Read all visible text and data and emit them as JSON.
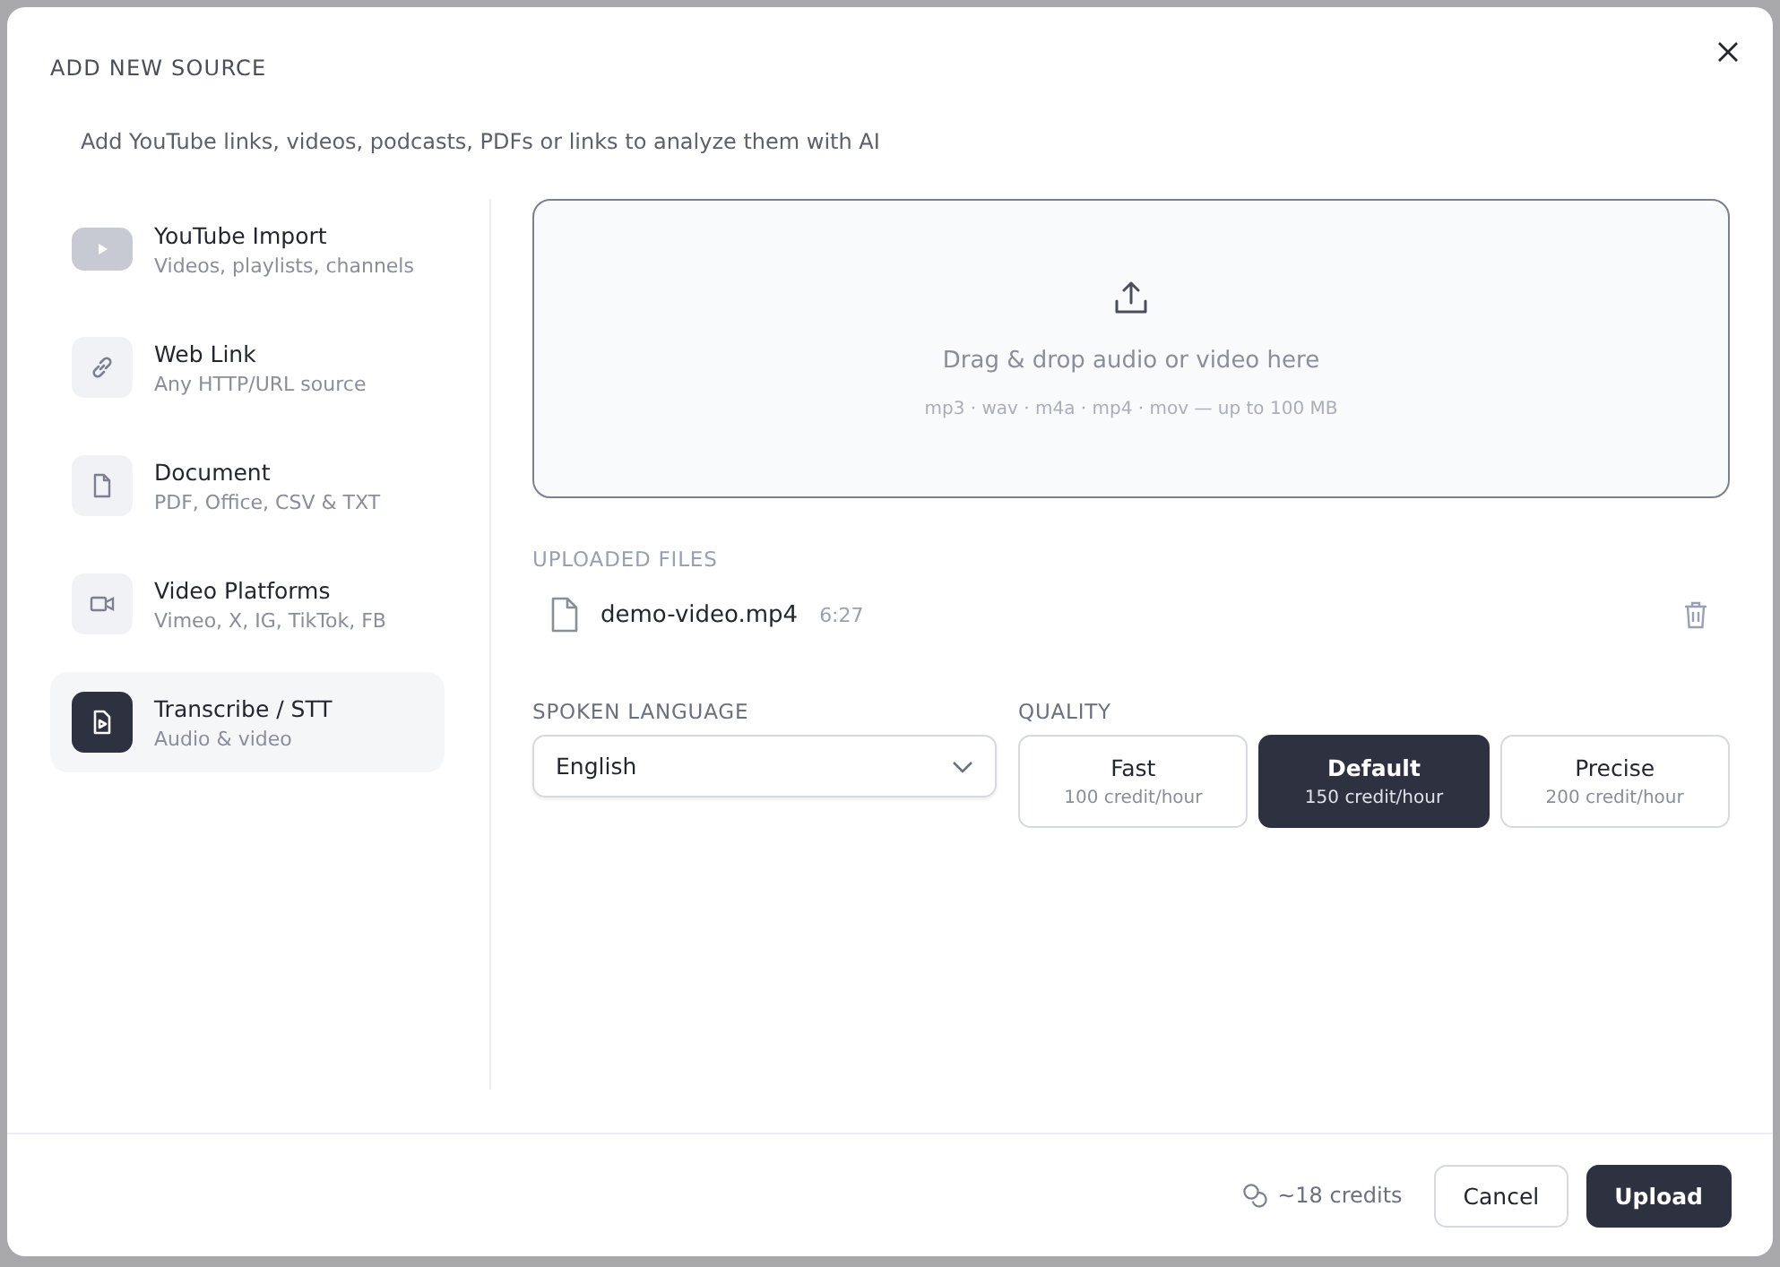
{
  "dialog": {
    "title": "ADD NEW SOURCE",
    "subtitle": "Add YouTube links, videos, podcasts, PDFs or links to analyze them with AI"
  },
  "sources": [
    {
      "kind": "youtube",
      "title": "YouTube Import",
      "description": "Videos, playlists, channels",
      "selected": false
    },
    {
      "kind": "link",
      "title": "Web Link",
      "description": "Any HTTP/URL source",
      "selected": false
    },
    {
      "kind": "document",
      "title": "Document",
      "description": "PDF, Office, CSV & TXT",
      "selected": false
    },
    {
      "kind": "video",
      "title": "Video Platforms",
      "description": "Vimeo, X, IG, TikTok, FB",
      "selected": false
    },
    {
      "kind": "transcribe",
      "title": "Transcribe / STT",
      "description": "Audio & video",
      "selected": true
    }
  ],
  "dropzone": {
    "prompt": "Drag & drop audio or video here",
    "formats": "mp3 · wav · m4a · mp4 · mov — up to 100 MB"
  },
  "uploaded_files": {
    "heading": "UPLOADED FILES",
    "files": [
      {
        "name": "demo-video.mp4",
        "duration": "6:27"
      }
    ]
  },
  "spoken_language": {
    "label": "SPOKEN LANGUAGE",
    "value": "English"
  },
  "quality": {
    "label": "QUALITY",
    "options": [
      {
        "name": "Fast",
        "rate": "100 credit/hour",
        "selected": false
      },
      {
        "name": "Default",
        "rate": "150 credit/hour",
        "selected": true
      },
      {
        "name": "Precise",
        "rate": "200 credit/hour",
        "selected": false
      }
    ]
  },
  "footer": {
    "credits": "~18 credits",
    "buttons": [
      {
        "kind": "secondary",
        "label": "Cancel"
      },
      {
        "kind": "primary",
        "label": "Upload"
      }
    ]
  }
}
